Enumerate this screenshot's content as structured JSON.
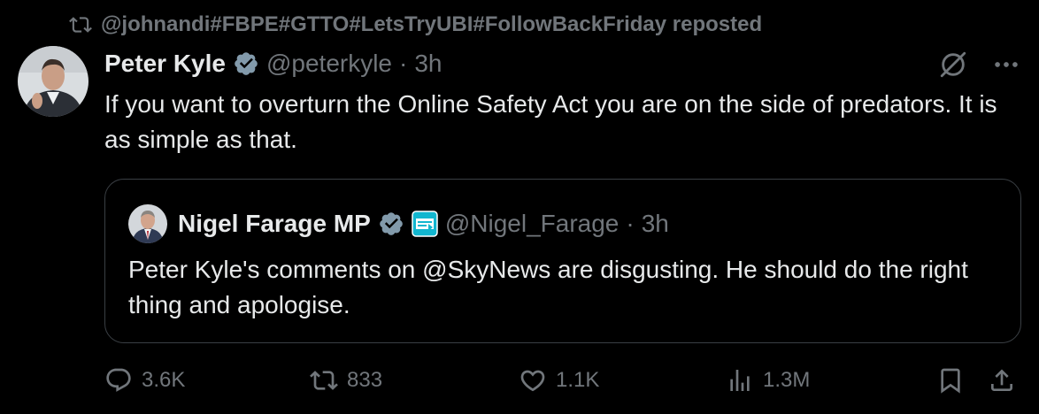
{
  "repost": {
    "text": "@johnandi#FBPE#GTTO#LetsTryUBI#FollowBackFriday reposted",
    "icon": "repost-icon"
  },
  "author": {
    "name": "Peter Kyle",
    "handle": "@peterkyle",
    "dot": "·",
    "time": "3h",
    "verified": true
  },
  "tweet": {
    "text": "If you want to overturn the Online Safety Act you are on the side of predators. It is as simple as that."
  },
  "quoted": {
    "name": "Nigel Farage MP",
    "handle": "@Nigel_Farage",
    "dot": "·",
    "time": "3h",
    "verified": true,
    "affiliation_icon": "reform-uk-badge",
    "text": "Peter Kyle's comments on @SkyNews are disgusting. He should do the right thing and apologise."
  },
  "actions": {
    "replies": "3.6K",
    "reposts": "833",
    "likes": "1.1K",
    "views": "1.3M"
  },
  "colors": {
    "background": "#000000",
    "text": "#e7e9ea",
    "muted": "#71767b",
    "border": "#3a3f44",
    "verified": "#829aab"
  }
}
